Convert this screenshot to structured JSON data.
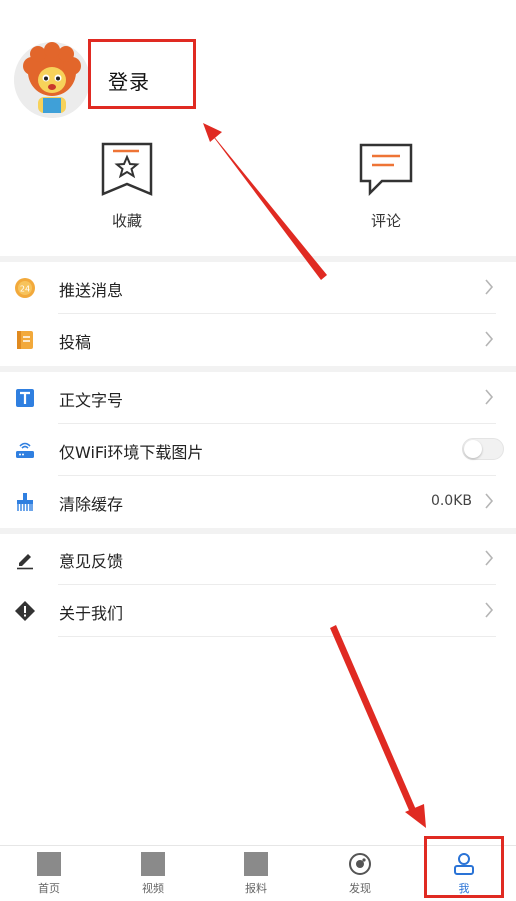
{
  "header": {
    "login_label": "登录"
  },
  "quick_actions": [
    {
      "label": "收藏",
      "icon": "bookmark-star-icon"
    },
    {
      "label": "评论",
      "icon": "comment-bubble-icon"
    }
  ],
  "menu": {
    "push": {
      "label": "推送消息",
      "icon": "24h-badge-icon"
    },
    "submit": {
      "label": "投稿",
      "icon": "notebook-icon"
    },
    "font_size": {
      "label": "正文字号",
      "icon": "text-t-icon"
    },
    "wifi_only": {
      "label": "仅WiFi环境下载图片",
      "icon": "router-icon",
      "enabled": false
    },
    "clear_cache": {
      "label": "清除缓存",
      "icon": "brush-icon",
      "value": "0.0KB"
    },
    "feedback": {
      "label": "意见反馈",
      "icon": "pencil-icon"
    },
    "about": {
      "label": "关于我们",
      "icon": "diamond-info-icon"
    }
  },
  "tabbar": {
    "tabs": [
      {
        "label": "首页"
      },
      {
        "label": "视频"
      },
      {
        "label": "报料"
      },
      {
        "label": "发现"
      },
      {
        "label": "我"
      }
    ],
    "active_index": 4
  },
  "colors": {
    "accent_blue": "#2a73d6",
    "icon_orange": "#ee7436",
    "annotation_red": "#e02a22"
  }
}
